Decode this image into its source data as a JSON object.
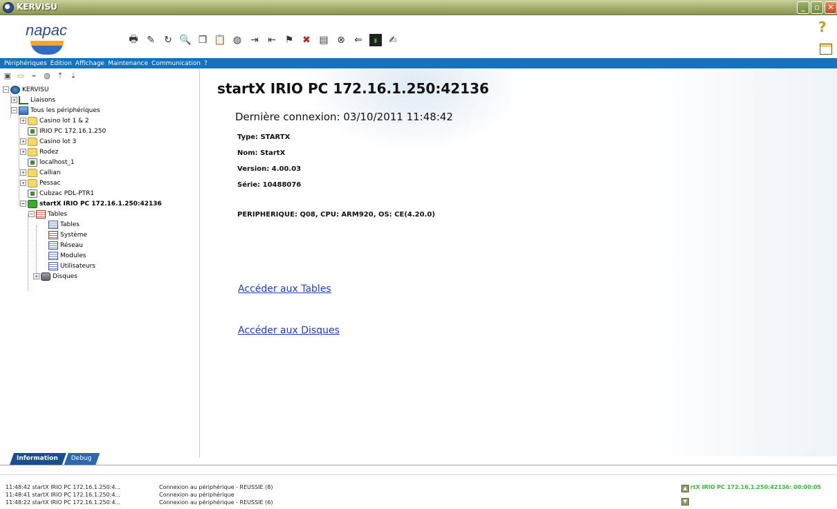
{
  "window": {
    "title": "KERVISU"
  },
  "toolbar": {
    "logo": "napac",
    "tools": [
      "print-icon",
      "edit-icon",
      "refresh-icon",
      "find-icon",
      "copy-icon",
      "paste-icon",
      "globe-icon",
      "import-icon",
      "export-icon",
      "flag-icon",
      "cross-flag-icon",
      "properties-icon",
      "stop-icon",
      "back-icon",
      "terminal-icon",
      "settings-icon"
    ]
  },
  "menu": {
    "items": [
      "Périphériques",
      "Edition",
      "Affichage",
      "Maintenance",
      "Communication",
      "?"
    ]
  },
  "tree": {
    "root": "KERVISU",
    "liaisons": "Liaisons",
    "all_devices": "Tous les périphériques",
    "items": {
      "casino12": "Casino lot 1 & 2",
      "irio": "IRIO PC 172.16.1.250",
      "casino3": "Casino lot 3",
      "rodez": "Rodez",
      "localhost": "localhost_1",
      "callian": "Callian",
      "pessac": "Pessac",
      "cubzac": "Cubzac PDL-PTR1",
      "startx": "startX IRIO PC 172.16.1.250:42136",
      "tables": "Tables",
      "tables_sub": "Tables",
      "systeme": "Système",
      "reseau": "Réseau",
      "modules": "Modules",
      "utilisateurs": "Utilisateurs",
      "disques": "Disques"
    }
  },
  "content": {
    "title": "startX IRIO PC 172.16.1.250:42136",
    "last_connection": "Dernière connexion: 03/10/2011 11:48:42",
    "type": "Type: STARTX",
    "nom": "Nom: StartX",
    "version": "Version: 4.00.03",
    "serie": "Série: 10488076",
    "peripherique": "PERIPHERIQUE: Q08,  CPU: ARM920,  OS: CE(4.20.0)",
    "link_tables": "Accéder aux Tables",
    "link_disques": "Accéder aux Disques"
  },
  "tabs": {
    "information": "Information",
    "debug": "Debug"
  },
  "log": [
    {
      "time_src": "11:48:42  startX IRIO PC 172.16.1.250:4...",
      "msg": "Connexion au périphérique - REUSSIE (8)"
    },
    {
      "time_src": "11:48:41  startX IRIO PC 172.16.1.250:4...",
      "msg": "Connexion au périphérique"
    },
    {
      "time_src": "11:48:22  startX IRIO PC 172.16.1.250:4...",
      "msg": "Connexion au périphérique - REUSSIE (6)"
    }
  ],
  "status": {
    "text": "rtX IRIO PC 172.16.1.250:42136: 00:00:05",
    "color": "#2fbf2f"
  }
}
